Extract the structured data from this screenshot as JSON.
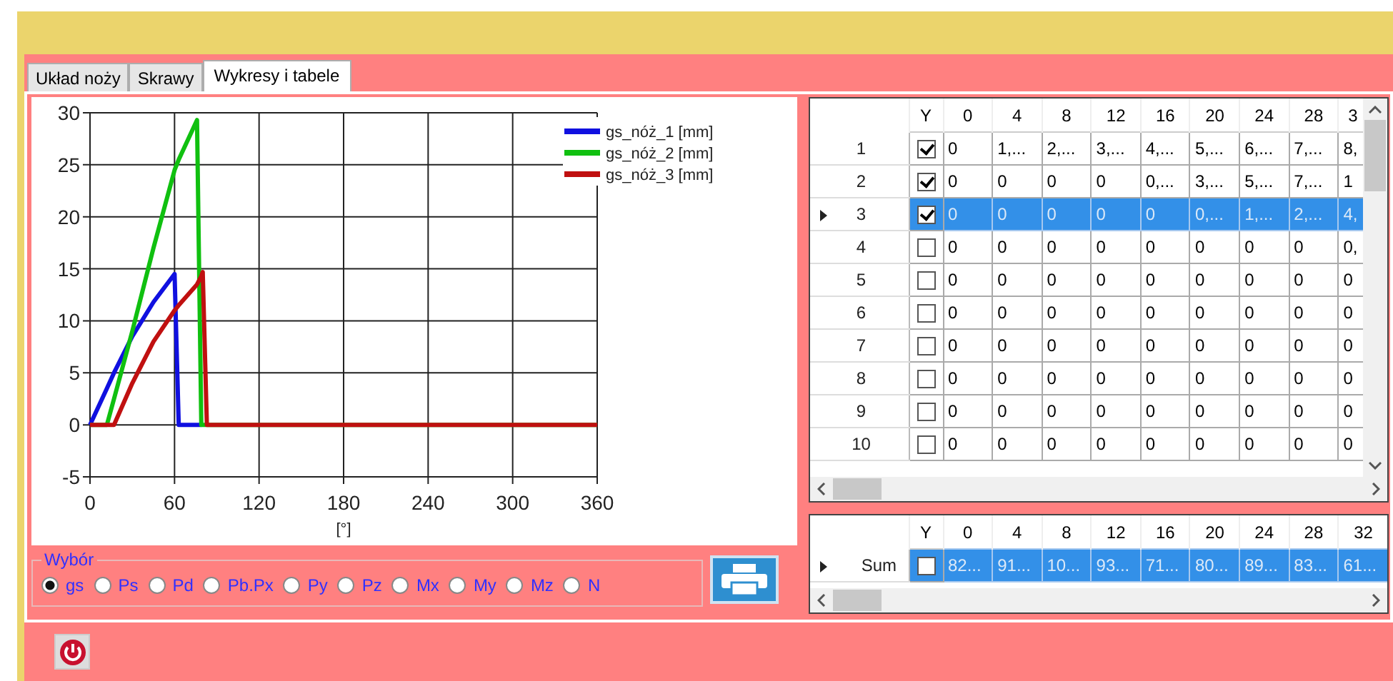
{
  "tabs": [
    {
      "label": "Układ noży",
      "selected": false
    },
    {
      "label": "Skrawy",
      "selected": false
    },
    {
      "label": "Wykresy i tabele",
      "selected": true
    }
  ],
  "chart": {
    "chart_data": {
      "type": "line",
      "xlabel": "[°]",
      "x": [
        0,
        12,
        17,
        30,
        45,
        60,
        63,
        76,
        79,
        80,
        83,
        360
      ],
      "xlim": [
        0,
        360
      ],
      "ylim": [
        -5,
        30
      ],
      "xticks": [
        0,
        60,
        120,
        180,
        240,
        300,
        360
      ],
      "yticks": [
        -5,
        0,
        5,
        10,
        15,
        20,
        25,
        30
      ],
      "grid": true,
      "legend": true,
      "series": [
        {
          "name": "gs_nóż_1 [mm]",
          "color": "#1010e0",
          "values": [
            0,
            3.5,
            5,
            8.5,
            11.8,
            14.5,
            0,
            0,
            0,
            null,
            null,
            null
          ]
        },
        {
          "name": "gs_nóż_2 [mm]",
          "color": "#10c010",
          "values": [
            0,
            0,
            2.5,
            9,
            17,
            24.5,
            25.5,
            29.3,
            0,
            0,
            0,
            0
          ]
        },
        {
          "name": "gs_nóż_3 [mm]",
          "color": "#c01010",
          "values": [
            0,
            0,
            0,
            4,
            8,
            11,
            11.5,
            13.5,
            14.3,
            14.7,
            0,
            0
          ]
        }
      ]
    }
  },
  "selection": {
    "title": "Wybór",
    "options": [
      {
        "label": "gs",
        "selected": true
      },
      {
        "label": "Ps",
        "selected": false
      },
      {
        "label": "Pd",
        "selected": false
      },
      {
        "label": "Pb.Px",
        "selected": false
      },
      {
        "label": "Py",
        "selected": false
      },
      {
        "label": "Pz",
        "selected": false
      },
      {
        "label": "Mx",
        "selected": false
      },
      {
        "label": "My",
        "selected": false
      },
      {
        "label": "Mz",
        "selected": false
      },
      {
        "label": "N",
        "selected": false
      }
    ]
  },
  "table": {
    "check_column": "Y",
    "columns": [
      "0",
      "4",
      "8",
      "12",
      "16",
      "20",
      "24",
      "28",
      "3"
    ],
    "rows": [
      {
        "header": "1",
        "checked": true,
        "selected": false,
        "cells": [
          "0",
          "1,...",
          "2,...",
          "3,...",
          "4,...",
          "5,...",
          "6,...",
          "7,...",
          "8,"
        ]
      },
      {
        "header": "2",
        "checked": true,
        "selected": false,
        "cells": [
          "0",
          "0",
          "0",
          "0",
          "0,...",
          "3,...",
          "5,...",
          "7,...",
          "1"
        ]
      },
      {
        "header": "3",
        "checked": true,
        "selected": true,
        "cells": [
          "0",
          "0",
          "0",
          "0",
          "0",
          "0,...",
          "1,...",
          "2,...",
          "4,"
        ]
      },
      {
        "header": "4",
        "checked": false,
        "selected": false,
        "cells": [
          "0",
          "0",
          "0",
          "0",
          "0",
          "0",
          "0",
          "0",
          "0,"
        ]
      },
      {
        "header": "5",
        "checked": false,
        "selected": false,
        "cells": [
          "0",
          "0",
          "0",
          "0",
          "0",
          "0",
          "0",
          "0",
          "0"
        ]
      },
      {
        "header": "6",
        "checked": false,
        "selected": false,
        "cells": [
          "0",
          "0",
          "0",
          "0",
          "0",
          "0",
          "0",
          "0",
          "0"
        ]
      },
      {
        "header": "7",
        "checked": false,
        "selected": false,
        "cells": [
          "0",
          "0",
          "0",
          "0",
          "0",
          "0",
          "0",
          "0",
          "0"
        ]
      },
      {
        "header": "8",
        "checked": false,
        "selected": false,
        "cells": [
          "0",
          "0",
          "0",
          "0",
          "0",
          "0",
          "0",
          "0",
          "0"
        ]
      },
      {
        "header": "9",
        "checked": false,
        "selected": false,
        "cells": [
          "0",
          "0",
          "0",
          "0",
          "0",
          "0",
          "0",
          "0",
          "0"
        ]
      },
      {
        "header": "10",
        "checked": false,
        "selected": false,
        "cells": [
          "0",
          "0",
          "0",
          "0",
          "0",
          "0",
          "0",
          "0",
          "0"
        ]
      }
    ]
  },
  "sum_table": {
    "check_column": "Y",
    "columns": [
      "0",
      "4",
      "8",
      "12",
      "16",
      "20",
      "24",
      "28",
      "32"
    ],
    "rows": [
      {
        "header": "Sum",
        "checked": false,
        "selected": true,
        "cells": [
          "82...",
          "91...",
          "10...",
          "93...",
          "71...",
          "80...",
          "89...",
          "83...",
          "61..."
        ]
      }
    ]
  }
}
